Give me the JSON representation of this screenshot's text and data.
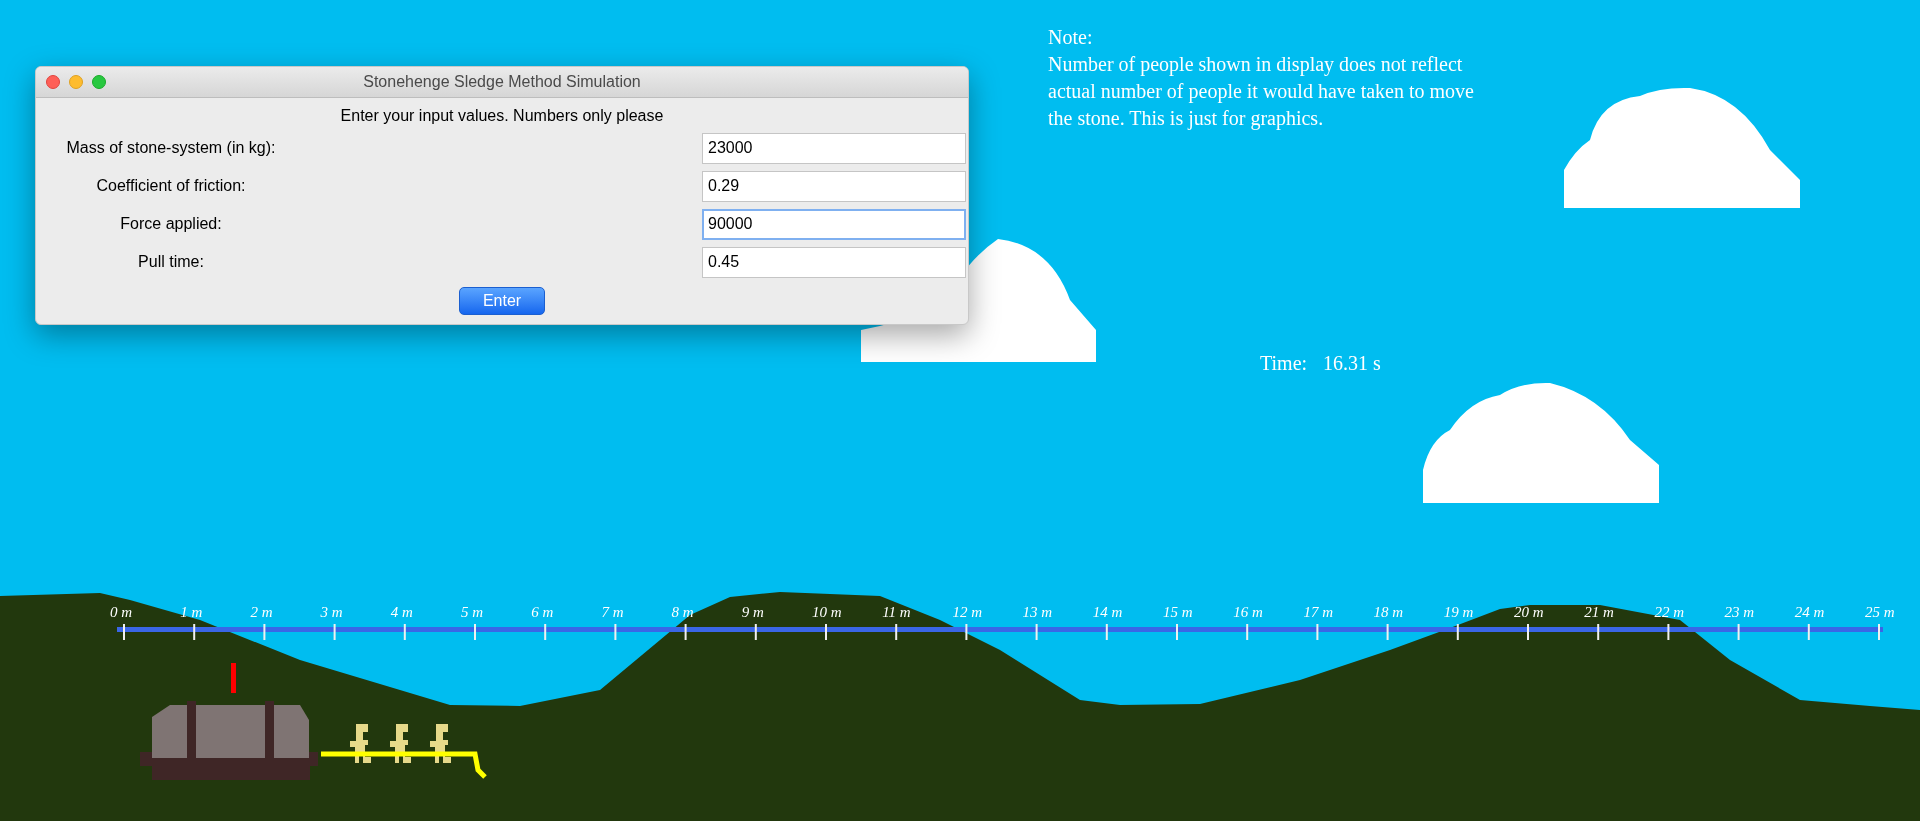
{
  "window": {
    "title": "Stonehenge Sledge Method Simulation",
    "heading": "Enter your input values. Numbers only please",
    "fields": [
      {
        "label": "Mass of stone-system (in kg):",
        "value": "23000",
        "focused": false
      },
      {
        "label": "Coefficient of friction:",
        "value": "0.29",
        "focused": false
      },
      {
        "label": "Force applied:",
        "value": "90000",
        "focused": true
      },
      {
        "label": "Pull time:",
        "value": "0.45",
        "focused": false
      }
    ],
    "button": "Enter"
  },
  "note": {
    "title": "Note:",
    "lines": [
      "Number of people shown in display does not reflect",
      "actual number of people it would have taken to move",
      "the stone. This is just for graphics."
    ]
  },
  "timer": {
    "label": "Time:",
    "value": "16.31 s"
  },
  "ruler": {
    "labels": [
      "0 m",
      "1 m",
      "2 m",
      "3 m",
      "4 m",
      "5 m",
      "6 m",
      "7 m",
      "8 m",
      "9 m",
      "10 m",
      "11 m",
      "12 m",
      "13 m",
      "14 m",
      "15 m",
      "16 m",
      "17 m",
      "18 m",
      "19 m",
      "20 m",
      "21 m",
      "22 m",
      "23 m",
      "24 m",
      "25 m"
    ]
  }
}
